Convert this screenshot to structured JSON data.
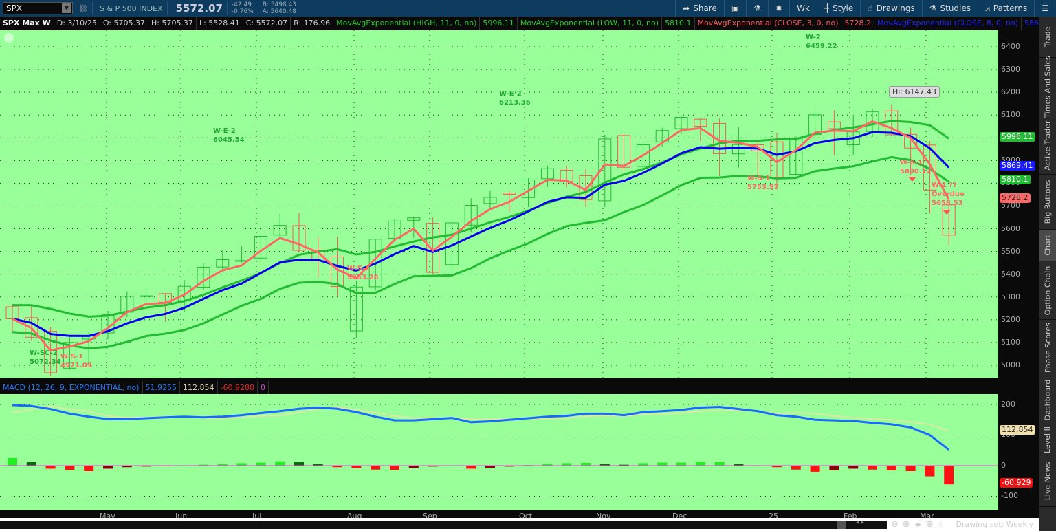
{
  "toolbar": {
    "symbol": "SPX",
    "name": "S & P 500 INDEX",
    "last": "5572.07",
    "change": "-42.49",
    "change_pct": "-0.76%",
    "bid": "B: 5498.43",
    "ask": "A: 5640.48",
    "buttons": [
      "Share",
      "",
      "",
      "",
      "Wk",
      "Style",
      "Drawings",
      "Studies",
      "Patterns",
      ""
    ]
  },
  "infobar": {
    "title": "SPX Max W",
    "date": "D: 3/10/25",
    "open": "O: 5705.37",
    "high": "H: 5705.37",
    "low": "L: 5528.41",
    "close": "C: 5572.07",
    "range": "R: 176.96",
    "studies": [
      {
        "label": "MovAvgExponential (HIGH, 11, 0, no)",
        "value": "5996.11",
        "color": "#22cc22"
      },
      {
        "label": "MovAvgExponential (LOW, 11, 0, no)",
        "value": "5810.1",
        "color": "#22cc22"
      },
      {
        "label": "MovAvgExponential (CLOSE, 3, 0, no)",
        "value": "5728.2",
        "color": "#ff5555"
      },
      {
        "label": "MovAvgExponential (CLOSE, 8, 0, no)",
        "value": "5869.41",
        "color": "#2222ff"
      }
    ]
  },
  "price_axis": {
    "ticks": [
      "6400",
      "6300",
      "6200",
      "6100",
      "6000",
      "5900",
      "5800",
      "5700",
      "5600",
      "5500",
      "5400",
      "5300",
      "5200",
      "5100",
      "5000"
    ],
    "tags": [
      {
        "value": "5996.11",
        "color": "#22bb33"
      },
      {
        "value": "5869.41",
        "color": "#1a1aff"
      },
      {
        "value": "5810.1",
        "color": "#22bb33"
      },
      {
        "value": "5728.2",
        "color": "#ff6666"
      }
    ]
  },
  "annotations": [
    {
      "line1": "W-E-2",
      "line2": "6045.54"
    },
    {
      "line1": "W-E-2",
      "line2": "6213.36"
    },
    {
      "line1": "W-2",
      "line2": "6459.22"
    },
    {
      "line1": "W-S-1",
      "line2": "5753.57"
    },
    {
      "line1": "W-S-1",
      "line2": "5800.12"
    },
    {
      "line1": "W-1 ??",
      "line2": "Overdue",
      "line3": "5658.53"
    },
    {
      "line1": "W-S-1",
      "line2": "5353.28"
    },
    {
      "line1": "W-SC-2",
      "line2": "5072.34"
    },
    {
      "line1": "W-S-1",
      "line2": "4971.09"
    }
  ],
  "hi_callout": "Hi: 6147.43",
  "macd": {
    "header": "MACD (12, 26, 9, EXPONENTIAL, no)",
    "value": "51.9255",
    "avg": "112.854",
    "diff": "-60.9288",
    "zero": "0",
    "ticks": [
      "200",
      "100",
      "0",
      "-100"
    ],
    "avg_tag": "112.854",
    "diff_tag": "-60.929"
  },
  "months": [
    "May",
    "Jun",
    "Jul",
    "Aug",
    "Sep",
    "Oct",
    "Nov",
    "Dec",
    "25",
    "Feb",
    "Mar"
  ],
  "bottom": {
    "drawing_set": "Drawing set: Weekly"
  },
  "sidebar": [
    "Trade",
    "Times And Sales",
    "Active Trader",
    "Big Buttons",
    "Chart",
    "Option Chain",
    "Phase Scores",
    "Dashboard",
    "Level II",
    "Live News"
  ],
  "colors": {
    "bg": "#99ff99",
    "up": "#22bb33",
    "down": "#ff5555",
    "ema_green": "#22bb33",
    "ema_red": "#ff6666",
    "ema_blue": "#0000ee"
  },
  "chart_data": {
    "type": "candlestick",
    "interval": "weekly",
    "ylim": [
      4950,
      6450
    ],
    "ohlc": [
      [
        5257,
        5264,
        5146,
        5204
      ],
      [
        5209,
        5263,
        5107,
        5123
      ],
      [
        5149,
        5168,
        4953,
        4967
      ],
      [
        4987,
        5123,
        4980,
        5100
      ],
      [
        5115,
        5146,
        5011,
        5128
      ],
      [
        5142,
        5239,
        5114,
        5223
      ],
      [
        5233,
        5325,
        5211,
        5303
      ],
      [
        5303,
        5342,
        5257,
        5305
      ],
      [
        5315,
        5315,
        5191,
        5277
      ],
      [
        5283,
        5375,
        5234,
        5347
      ],
      [
        5343,
        5447,
        5331,
        5431
      ],
      [
        5432,
        5505,
        5420,
        5464
      ],
      [
        5460,
        5523,
        5451,
        5460
      ],
      [
        5471,
        5570,
        5446,
        5567
      ],
      [
        5572,
        5666,
        5554,
        5615
      ],
      [
        5614,
        5669,
        5497,
        5505
      ],
      [
        5506,
        5566,
        5390,
        5459
      ],
      [
        5476,
        5566,
        5302,
        5346
      ],
      [
        5151,
        5370,
        5119,
        5344
      ],
      [
        5345,
        5555,
        5329,
        5554
      ],
      [
        5558,
        5643,
        5549,
        5634
      ],
      [
        5637,
        5651,
        5560,
        5648
      ],
      [
        5624,
        5651,
        5402,
        5408
      ],
      [
        5442,
        5636,
        5406,
        5626
      ],
      [
        5616,
        5733,
        5584,
        5703
      ],
      [
        5711,
        5767,
        5686,
        5738
      ],
      [
        5757,
        5768,
        5674,
        5751
      ],
      [
        5737,
        5822,
        5696,
        5815
      ],
      [
        5820,
        5878,
        5784,
        5864
      ],
      [
        5857,
        5878,
        5782,
        5808
      ],
      [
        5833,
        5863,
        5696,
        5728
      ],
      [
        5723,
        6013,
        5696,
        5995
      ],
      [
        6010,
        6018,
        5853,
        5870
      ],
      [
        5874,
        5979,
        5858,
        5969
      ],
      [
        5982,
        6044,
        5960,
        6032
      ],
      [
        6040,
        6099,
        6016,
        6090
      ],
      [
        6082,
        6085,
        5985,
        6051
      ],
      [
        6063,
        6085,
        5832,
        5930
      ],
      [
        5929,
        6049,
        5869,
        5970
      ],
      [
        5969,
        5984,
        5823,
        5942
      ],
      [
        5982,
        6022,
        5773,
        5827
      ],
      [
        5839,
        6006,
        5836,
        5997
      ],
      [
        6015,
        6128,
        6000,
        6101
      ],
      [
        6070,
        6120,
        5923,
        6040
      ],
      [
        5969,
        6101,
        5924,
        6026
      ],
      [
        6026,
        6128,
        6004,
        6115
      ],
      [
        6118,
        6147,
        6008,
        6013
      ],
      [
        6015,
        6044,
        5837,
        5955
      ],
      [
        5968,
        5986,
        5667,
        5770
      ],
      [
        5705,
        5705,
        5528,
        5572
      ]
    ],
    "macd_value": [
      198,
      195,
      185,
      170,
      160,
      152,
      152,
      155,
      158,
      160,
      158,
      160,
      165,
      172,
      178,
      186,
      190,
      186,
      175,
      160,
      148,
      148,
      152,
      156,
      142,
      145,
      150,
      155,
      160,
      163,
      170,
      170,
      165,
      175,
      178,
      182,
      190,
      192,
      185,
      178,
      165,
      160,
      150,
      148,
      146,
      140,
      135,
      125,
      100,
      52
    ],
    "macd_hist": [
      25,
      12,
      -10,
      -14,
      -18,
      -10,
      -5,
      -3,
      -2,
      0,
      3,
      5,
      8,
      10,
      14,
      12,
      5,
      -5,
      -8,
      -13,
      -14,
      -8,
      -3,
      0,
      -10,
      -7,
      -3,
      2,
      6,
      8,
      9,
      6,
      3,
      8,
      10,
      10,
      12,
      12,
      5,
      0,
      -5,
      -13,
      -20,
      -15,
      -10,
      -13,
      -15,
      -18,
      -35,
      -61
    ],
    "macd_ylim": [
      -130,
      230
    ]
  }
}
